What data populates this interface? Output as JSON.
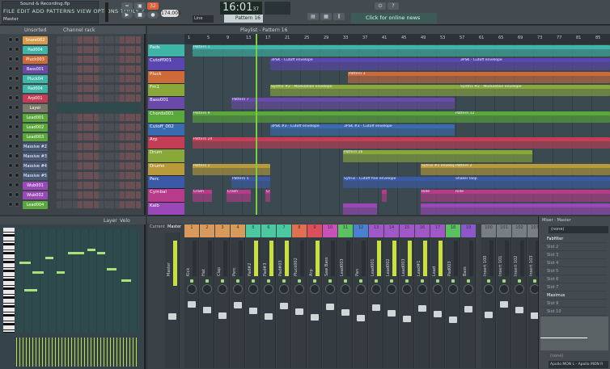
{
  "app": {
    "title": "Sound & Recording.flp",
    "menu": "FILE  EDIT  ADD  PATTERNS  VIEW  OPTIONS  TOOLS  ?",
    "hint": "Master"
  },
  "transport": {
    "time": "16:01",
    "time_sub": "37",
    "tempo": "174.000",
    "pattern": "Pattern 16",
    "news": "Click for online news",
    "snap": "Line"
  },
  "channel_rack": {
    "title": "Channel rack",
    "filter": "Unsorted",
    "channels": [
      {
        "name": "Snare062",
        "color": "#d89a4a"
      },
      {
        "name": "Pad004",
        "color": "#3fb5a8"
      },
      {
        "name": "Pluck003",
        "color": "#cc6a3a"
      },
      {
        "name": "Bass001",
        "color": "#6a4aa8"
      },
      {
        "name": "Pluck04",
        "color": "#3fb5a8"
      },
      {
        "name": "Pad004",
        "color": "#3fb5a8"
      },
      {
        "name": "Arp001",
        "color": "#c43c55"
      },
      {
        "name": "Layer",
        "color": "#7a7a6a"
      },
      {
        "name": "Lead001",
        "color": "#5aa83a"
      },
      {
        "name": "Lead002",
        "color": "#5aa83a"
      },
      {
        "name": "Lead003",
        "color": "#5aa83a"
      },
      {
        "name": "Massive #2",
        "color": "#4a5878"
      },
      {
        "name": "Massive #3",
        "color": "#4a5878"
      },
      {
        "name": "Massive #4",
        "color": "#4a5878"
      },
      {
        "name": "Massive #5",
        "color": "#4a5878"
      },
      {
        "name": "Wub001",
        "color": "#9a48b8"
      },
      {
        "name": "Wub002",
        "color": "#9a48b8"
      },
      {
        "name": "Lead004",
        "color": "#5aa83a"
      }
    ]
  },
  "playlist": {
    "title": "Playlist - Pattern 16",
    "ruler": [
      "1",
      "5",
      "9",
      "13",
      "17",
      "21",
      "25",
      "29",
      "33",
      "37",
      "41",
      "45",
      "49",
      "53",
      "57",
      "61",
      "65",
      "69",
      "73",
      "77",
      "81",
      "85"
    ],
    "playhead_bar": 15,
    "tracks": [
      {
        "name": "Pads",
        "color": "#3fb5a8",
        "clips": [
          [
            2,
            88,
            "Pattern 1"
          ]
        ]
      },
      {
        "name": "Cutoff001",
        "color": "#5a46b0",
        "clips": [
          [
            18,
            57,
            "3PSK - Cutoff envelope"
          ],
          [
            57,
            88,
            "3PSK - Cutoff envelope"
          ]
        ]
      },
      {
        "name": "Pluck",
        "color": "#cc6a3a",
        "clips": [
          [
            34,
            88,
            "Pattern 3"
          ]
        ]
      },
      {
        "name": "Fm1",
        "color": "#8aa83a",
        "clips": [
          [
            18,
            57,
            "Synth1 #2 - Modulation envelope"
          ],
          [
            57,
            88,
            "Synth1 #2 - Modulation envelope"
          ]
        ]
      },
      {
        "name": "Bass001",
        "color": "#6a4aa8",
        "clips": [
          [
            10,
            56,
            "Pattern 7"
          ]
        ]
      },
      {
        "name": "Chords001",
        "color": "#5aa83a",
        "clips": [
          [
            2,
            56,
            "Pattern 9"
          ],
          [
            56,
            88,
            "Pattern 12"
          ]
        ]
      },
      {
        "name": "Cutoff_002",
        "color": "#3a6ab0",
        "clips": [
          [
            18,
            33,
            "3PSK #3 - Cutoff envelope"
          ],
          [
            33,
            56,
            "3PSK #3 - Cutoff envelope"
          ]
        ]
      },
      {
        "name": "Arp",
        "color": "#c43c55",
        "clips": [
          [
            2,
            88,
            "Pattern 24"
          ]
        ]
      },
      {
        "name": "Drum",
        "color": "#8aa83a",
        "clips": [
          [
            33,
            72,
            "Pattern 16"
          ]
        ]
      },
      {
        "name": "Drums",
        "color": "#b89a3a",
        "clips": [
          [
            2,
            18,
            "Pattern 2"
          ],
          [
            49,
            56,
            "Sytrus #1 envelope"
          ],
          [
            56,
            88,
            "Pattern 2"
          ]
        ]
      },
      {
        "name": "Perc",
        "color": "#3a5aa8",
        "clips": [
          [
            10,
            18,
            "Pattern 5"
          ],
          [
            33,
            56,
            "Sytrus - Cutoff fine envelope"
          ],
          [
            56,
            88,
            "Shaker loop"
          ]
        ]
      },
      {
        "name": "Cymbal",
        "color": "#b83a8a",
        "clips": [
          [
            2,
            6,
            "Crash"
          ],
          [
            9,
            14,
            "Crash"
          ],
          [
            17,
            18,
            "Crash"
          ],
          [
            41,
            42,
            ""
          ],
          [
            49,
            56,
            "Ride"
          ],
          [
            56,
            88,
            "Ride"
          ]
        ]
      },
      {
        "name": "Kalb",
        "color": "#9a48b8",
        "clips": [
          [
            33,
            40,
            ""
          ],
          [
            49,
            88,
            ""
          ]
        ]
      }
    ]
  },
  "piano_roll": {
    "title": "Layer",
    "mode": "Velo"
  },
  "mixer": {
    "tabs": [
      "Current",
      "Master"
    ],
    "master": "Master",
    "inserts": [
      {
        "n": "1",
        "name": "Kick",
        "color": "#d89a5a"
      },
      {
        "n": "2",
        "name": "Hat",
        "color": "#d89a5a"
      },
      {
        "n": "3",
        "name": "Clap",
        "color": "#d89a5a"
      },
      {
        "n": "4",
        "name": "Perc",
        "color": "#d89a5a"
      },
      {
        "n": "5",
        "name": "Pad#2",
        "color": "#4cc8a0"
      },
      {
        "n": "6",
        "name": "Pad#3",
        "color": "#4cc8a0"
      },
      {
        "n": "7",
        "name": "Pad#03",
        "color": "#4cc8a0"
      },
      {
        "n": "8",
        "name": "Pluck002",
        "color": "#e07050"
      },
      {
        "n": "9",
        "name": "Arp",
        "color": "#d9505a"
      },
      {
        "n": "10",
        "name": "Saw Bass",
        "color": "#c850b8"
      },
      {
        "n": "11",
        "name": "Lead003",
        "color": "#5ac060"
      },
      {
        "n": "12",
        "name": "Pan",
        "color": "#4a80d0"
      },
      {
        "n": "13",
        "name": "Lead001",
        "color": "#a058c8"
      },
      {
        "n": "14",
        "name": "Lead002",
        "color": "#a058c8"
      },
      {
        "n": "15",
        "name": "Lead003",
        "color": "#a058c8"
      },
      {
        "n": "16",
        "name": "Lead#1",
        "color": "#a058c8"
      },
      {
        "n": "17",
        "name": "Lead",
        "color": "#a058c8"
      },
      {
        "n": "18",
        "name": "Pad003",
        "color": "#5ac060"
      },
      {
        "n": "19",
        "name": "Bass",
        "color": "#8a58c8"
      },
      {
        "n": "100",
        "name": "Insert 100",
        "color": "#777f84"
      },
      {
        "n": "101",
        "name": "Insert 101",
        "color": "#777f84"
      },
      {
        "n": "102",
        "name": "Insert 102",
        "color": "#777f84"
      },
      {
        "n": "103",
        "name": "Insert 103",
        "color": "#777f84"
      }
    ],
    "side": {
      "title": "Mixer - Master",
      "preset": "(none)",
      "slots": [
        "Fabfilter",
        "Slot 2",
        "Slot 3",
        "Slot 4",
        "Slot 5",
        "Slot 6",
        "Slot 7",
        "Maximus",
        "Slot 9",
        "Slot 10"
      ],
      "eq": "(none)",
      "output": "Apollo MON L - Apollo MON R"
    }
  },
  "colors": {
    "accent": "#c8e040",
    "bg": "#36434a"
  }
}
